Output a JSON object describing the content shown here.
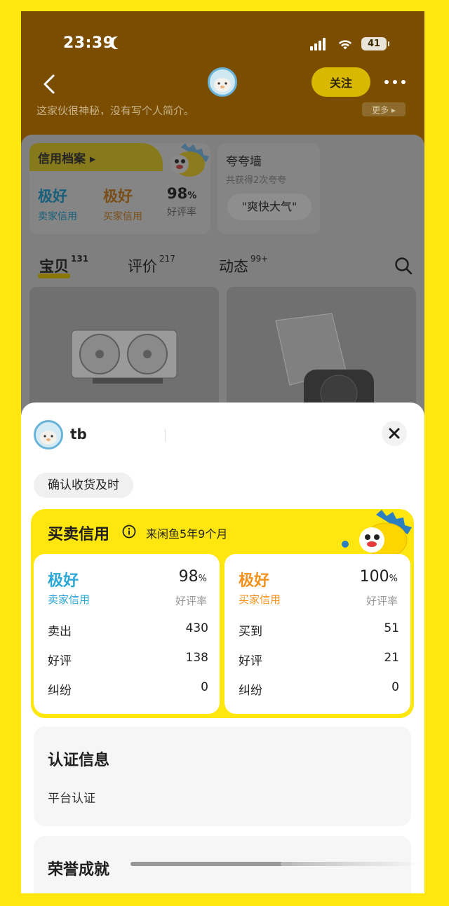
{
  "status_bar": {
    "time": "23:39",
    "battery": "41"
  },
  "header": {
    "follow_label": "关注",
    "bio": "这家伙很神秘，没有写个人简介。",
    "bio_more": "更多 ▸"
  },
  "profile": {
    "credit_tab": "信用档案 ▸",
    "seller_grade": "极好",
    "seller_label": "卖家信用",
    "buyer_grade": "极好",
    "buyer_label": "买家信用",
    "rate": "98",
    "rate_unit": "%",
    "rate_label": "好评率",
    "praise_title": "夸夸墙",
    "praise_sub": "共获得2次夸夸",
    "praise_chip": "\"爽快大气\""
  },
  "tabs": [
    {
      "label": "宝贝",
      "count": "131"
    },
    {
      "label": "评价",
      "count": "217"
    },
    {
      "label": "动态",
      "count": "99+"
    }
  ],
  "sheet": {
    "name": "tb",
    "chip": "确认收货及时",
    "credit_title": "买卖信用",
    "since": "来闲鱼5年9个月",
    "seller": {
      "grade": "极好",
      "grade_label": "卖家信用",
      "rate": "98",
      "rate_unit": "%",
      "rate_label": "好评率",
      "rows": [
        {
          "k": "卖出",
          "v": "430"
        },
        {
          "k": "好评",
          "v": "138"
        },
        {
          "k": "纠纷",
          "v": "0"
        }
      ]
    },
    "buyer": {
      "grade": "极好",
      "grade_label": "买家信用",
      "rate": "100",
      "rate_unit": "%",
      "rate_label": "好评率",
      "rows": [
        {
          "k": "买到",
          "v": "51"
        },
        {
          "k": "好评",
          "v": "21"
        },
        {
          "k": "纠纷",
          "v": "0"
        }
      ]
    },
    "cert_title": "认证信息",
    "cert_item": "平台认证",
    "honor_title": "荣誉成就"
  },
  "colors": {
    "brand_yellow": "#FFE60F",
    "seller_blue": "#2BA8D8",
    "buyer_orange": "#F5921E"
  }
}
